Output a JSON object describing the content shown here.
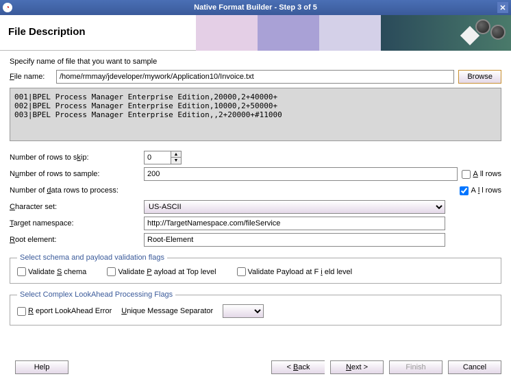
{
  "window": {
    "title": "Native Format Builder - Step 3 of 5"
  },
  "header": {
    "title": "File Description"
  },
  "instruction": "Specify name of file that you want to sample",
  "labels": {
    "filename": "File name:",
    "browse": "Browse",
    "rowsSkip": "Number of rows to skip:",
    "rowsSample": "Number of rows to sample:",
    "rowsProcess": "Number of data rows to process:",
    "charset": "Character set:",
    "targetNs": "Target namespace:",
    "rootEl": "Root element:",
    "allRows": "All rows",
    "fs1": "Select schema and payload validation flags",
    "valSchema": "Validate Schema",
    "valTop": "Validate Payload at Top level",
    "valField": "Validate Payload at Field level",
    "fs2": "Select Complex LookAhead Processing Flags",
    "reportLA": "Report LookAhead Error",
    "uniqueSep": "Unique Message Separator"
  },
  "values": {
    "filename": "/home/rmmay/jdeveloper/mywork/Application10/Invoice.txt",
    "rowsSkip": "0",
    "rowsSample": "200",
    "rowsProcess": "",
    "charset": "US-ASCII",
    "targetNs": "http://TargetNamespace.com/fileService",
    "rootEl": "Root-Element",
    "uniqueSep": ""
  },
  "checks": {
    "allRowsSample": false,
    "allRowsProcess": true,
    "valSchema": false,
    "valTop": false,
    "valField": false,
    "reportLA": false
  },
  "preview": "001|BPEL Process Manager Enterprise Edition,20000,2+40000+\n002|BPEL Process Manager Enterprise Edition,10000,2+50000+\n003|BPEL Process Manager Enterprise Edition,,2+20000+#11000",
  "footer": {
    "help": "Help",
    "back": "< Back",
    "next": "Next >",
    "finish": "Finish",
    "cancel": "Cancel"
  }
}
